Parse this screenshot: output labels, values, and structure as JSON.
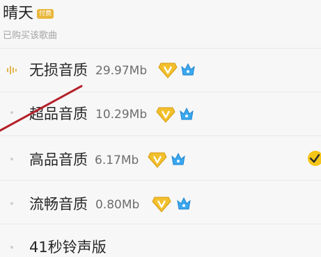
{
  "header": {
    "title": "晴天",
    "badge": "付费",
    "subtitle": "已购买该歌曲"
  },
  "quality_options": [
    {
      "label": "无损音质",
      "size": "29.97Mb",
      "icon": "playing-bars-icon",
      "selected": false
    },
    {
      "label": "超品音质",
      "size": "10.29Mb",
      "icon": "dot-icon",
      "selected": false
    },
    {
      "label": "高品音质",
      "size": "6.17Mb",
      "icon": "dot-icon",
      "selected": true
    },
    {
      "label": "流畅音质",
      "size": "0.80Mb",
      "icon": "dot-icon",
      "selected": false
    },
    {
      "label": "41秒铃声版",
      "icon": "dot-icon"
    }
  ],
  "colors": {
    "diamond": "#f2c02c",
    "crown": "#3aa8ef",
    "check": "#f5c518",
    "arrow": "#b5202a"
  }
}
